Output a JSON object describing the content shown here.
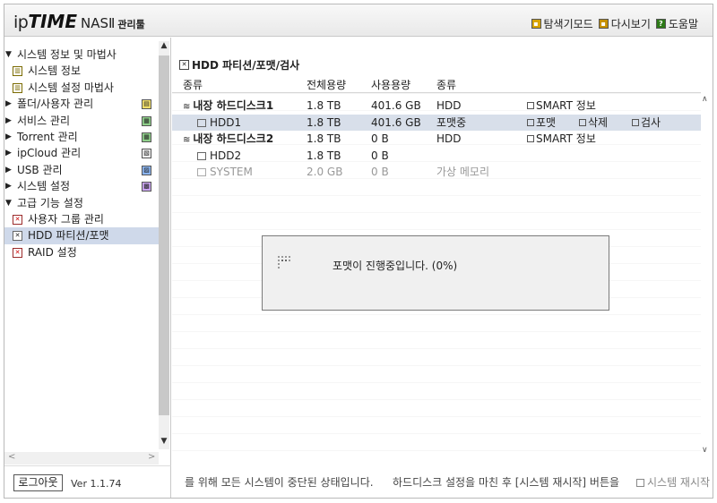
{
  "header": {
    "brand_ip": "ip",
    "brand_time": "TIME",
    "brand_nas": "NASⅡ",
    "brand_admin": "관리툴",
    "links": [
      "탐색기모드",
      "다시보기",
      "도움말"
    ]
  },
  "sidebar": {
    "items": [
      {
        "label": "시스템 정보 및 마법사",
        "level": 0,
        "arrow": "▼"
      },
      {
        "label": "시스템 정보",
        "level": 1
      },
      {
        "label": "시스템 설정 마법사",
        "level": 1
      },
      {
        "label": "폴더/사용자 관리",
        "level": 0,
        "arrow": "▶"
      },
      {
        "label": "서비스 관리",
        "level": 0,
        "arrow": "▶"
      },
      {
        "label": "Torrent 관리",
        "level": 0,
        "arrow": "▶"
      },
      {
        "label": "ipCloud 관리",
        "level": 0,
        "arrow": "▶"
      },
      {
        "label": "USB 관리",
        "level": 0,
        "arrow": "▶"
      },
      {
        "label": "시스템 설정",
        "level": 0,
        "arrow": "▶"
      },
      {
        "label": "고급 기능 설정",
        "level": 0,
        "arrow": "▼"
      },
      {
        "label": "사용자 그룹 관리",
        "level": 1
      },
      {
        "label": "HDD 파티션/포맷",
        "level": 1,
        "selected": true
      },
      {
        "label": "RAID 설정",
        "level": 1
      }
    ],
    "logout": "로그아웃",
    "version": "Ver 1.1.74"
  },
  "main": {
    "title": "HDD 파티션/포맷/검사",
    "columns": [
      "종류",
      "전체용량",
      "사용용량",
      "종류"
    ],
    "rows": [
      {
        "name": "내장 하드디스크1",
        "total": "1.8 TB",
        "used": "401.6 GB",
        "type": "HDD",
        "actions": [
          "SMART 정보"
        ]
      },
      {
        "name": "HDD1",
        "total": "1.8 TB",
        "used": "401.6 GB",
        "type": "포맷중",
        "actions": [
          "포맷",
          "삭제",
          "검사"
        ]
      },
      {
        "name": "내장 하드디스크2",
        "total": "1.8 TB",
        "used": "0 B",
        "type": "HDD",
        "actions": [
          "SMART 정보"
        ]
      },
      {
        "name": "HDD2",
        "total": "1.8 TB",
        "used": "0 B",
        "type": "",
        "actions": []
      },
      {
        "name": "SYSTEM",
        "total": "2.0 GB",
        "used": "0 B",
        "type": "가상 메모리",
        "actions": []
      }
    ],
    "footer": {
      "text1": "를 위해 모든 시스템이 중단된 상태입니다.",
      "text2": "하드디스크 설정을 마친 후 [시스템 재시작] 버튼을",
      "text3": "시스템 재시작"
    }
  },
  "dialog": {
    "message": "포맷이 진행중입니다. (0%)"
  }
}
